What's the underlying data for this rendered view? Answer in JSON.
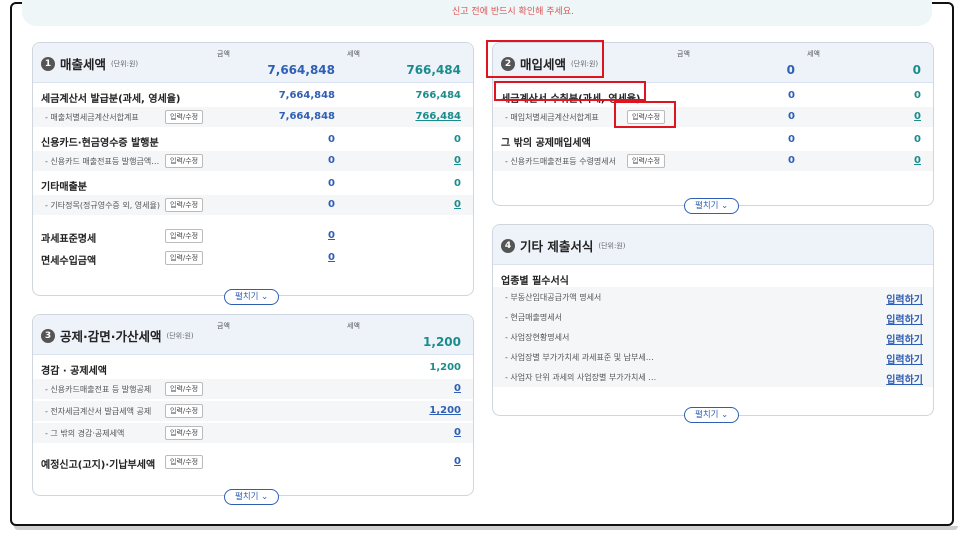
{
  "notice": {
    "text": "신고 전에 반드시 확인해 주세요."
  },
  "sales": {
    "badge": "1",
    "title": "매출세액",
    "unit": "(단위:원)",
    "amount_label": "금액",
    "tax_label": "세액",
    "amount_total": "7,664,848",
    "tax_total": "766,484",
    "rows": {
      "r1": {
        "label": "세금계산서 발급분(과세, 영세율)",
        "amount": "7,664,848",
        "tax": "766,484"
      },
      "r1s": {
        "label": "- 매출처별세금계산서합계표",
        "button": "입력/수정",
        "amount": "7,664,848",
        "tax": "766,484"
      },
      "r2": {
        "label": "신용카드·현금영수증 발행분",
        "amount": "0",
        "tax": "0"
      },
      "r2s": {
        "label": "- 신용카드 매출전표등 발행금액…",
        "button": "입력/수정",
        "amount": "0",
        "tax": "0"
      },
      "r3": {
        "label": "기타매출분",
        "amount": "0",
        "tax": "0"
      },
      "r3s": {
        "label": "- 기타정목(정규영수증 외, 영세율)",
        "button": "입력/수정",
        "amount": "0",
        "tax": "0"
      },
      "r4": {
        "label": "과세표준명세",
        "button": "입력/수정",
        "amount": "0"
      },
      "r5": {
        "label": "면세수입금액",
        "button": "입력/수정",
        "amount": "0"
      }
    },
    "expand": "펼치기 ⌄"
  },
  "purchase": {
    "badge": "2",
    "title": "매입세액",
    "unit": "(단위:원)",
    "amount_label": "금액",
    "tax_label": "세액",
    "amount_total": "0",
    "tax_total": "0",
    "rows": {
      "r1": {
        "label": "세금계산서 수취분(과세, 영세율)",
        "amount": "0",
        "tax": "0"
      },
      "r1s": {
        "label": "- 매입처별세금계산서합계표",
        "button": "입력/수정",
        "amount": "0",
        "tax": "0"
      },
      "r2": {
        "label": "그 밖의 공제매입세액",
        "amount": "0",
        "tax": "0"
      },
      "r2s": {
        "label": "- 신용카드매출전표등 수령명세서",
        "button": "입력/수정",
        "amount": "0",
        "tax": "0"
      }
    },
    "expand": "펼치기 ⌄"
  },
  "deduction": {
    "badge": "3",
    "title": "공제·감면·가산세액",
    "unit": "(단위:원)",
    "amount_label": "금액",
    "tax_label": "세액",
    "tax_total": "1,200",
    "rows": {
      "r1": {
        "label": "경감 · 공제세액",
        "tax": "1,200"
      },
      "r1s": {
        "label": "- 신용카드매출전표 등 발행공제",
        "button": "입력/수정",
        "tax": "0"
      },
      "r2s": {
        "label": "- 전자세금계산서 발급세액 공제",
        "button": "입력/수정",
        "tax": "1,200"
      },
      "r3s": {
        "label": "- 그 밖의 경감·공제세액",
        "button": "입력/수정",
        "tax": "0"
      },
      "r4": {
        "label": "예정신고(고지)·기납부세액",
        "button": "입력/수정",
        "tax": "0"
      }
    },
    "expand": "펼치기 ⌄"
  },
  "other": {
    "badge": "4",
    "title": "기타 제출서식",
    "unit": "(단위:원)",
    "section_label": "업종별 필수서식",
    "link_text": "입력하기",
    "items": [
      "- 부동산임대공급가액 명세서",
      "- 현금매출명세서",
      "- 사업장현황명세서",
      "- 사업장별 부가가치세 과세표준 및 납부세…",
      "- 사업자 단위 과세의 사업장별 부가가치세 …"
    ],
    "expand": "펼치기 ⌄"
  },
  "colors": {
    "accent_blue": "#2f5fb5",
    "accent_teal": "#1b8c8c",
    "highlight_red": "#e0141e"
  }
}
